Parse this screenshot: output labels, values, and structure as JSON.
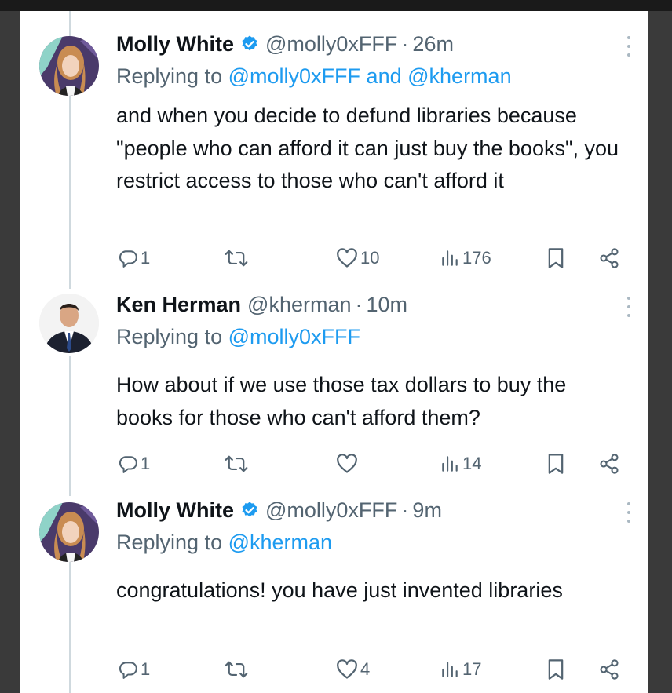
{
  "tweets": [
    {
      "name": "Molly White",
      "verified": true,
      "handle": "@molly0xFFF",
      "separator": "·",
      "time": "26m",
      "replying_prefix": "Replying to",
      "replying_mentions": [
        "@molly0xFFF",
        "@kherman"
      ],
      "replying_joiner": "and",
      "text": "and when you decide to defund libraries because \"people who can afford it can just buy the books\", you restrict access to those who can't afford it",
      "actions": {
        "replies": "1",
        "retweets": "",
        "likes": "10",
        "views": "176"
      }
    },
    {
      "name": "Ken Herman",
      "verified": false,
      "handle": "@kherman",
      "separator": "·",
      "time": "10m",
      "replying_prefix": "Replying to",
      "replying_mentions": [
        "@molly0xFFF"
      ],
      "text": "How about if we use those tax dollars to buy the books for those who can't afford them?",
      "actions": {
        "replies": "1",
        "retweets": "",
        "likes": "",
        "views": "14"
      }
    },
    {
      "name": "Molly White",
      "verified": true,
      "handle": "@molly0xFFF",
      "separator": "·",
      "time": "9m",
      "replying_prefix": "Replying to",
      "replying_mentions": [
        "@kherman"
      ],
      "text": "congratulations! you have just invented libraries",
      "actions": {
        "replies": "1",
        "retweets": "",
        "likes": "4",
        "views": "17"
      }
    }
  ],
  "colors": {
    "accent": "#1d9bf0",
    "text": "#0f1419",
    "secondary": "#536471",
    "thread_line": "#cfd9de",
    "background": "#ffffff"
  },
  "icons": {
    "reply": "reply-icon",
    "retweet": "retweet-icon",
    "like": "heart-icon",
    "views": "views-icon",
    "bookmark": "bookmark-icon",
    "share": "share-icon",
    "more": "more-icon",
    "verified": "verified-badge-icon"
  }
}
